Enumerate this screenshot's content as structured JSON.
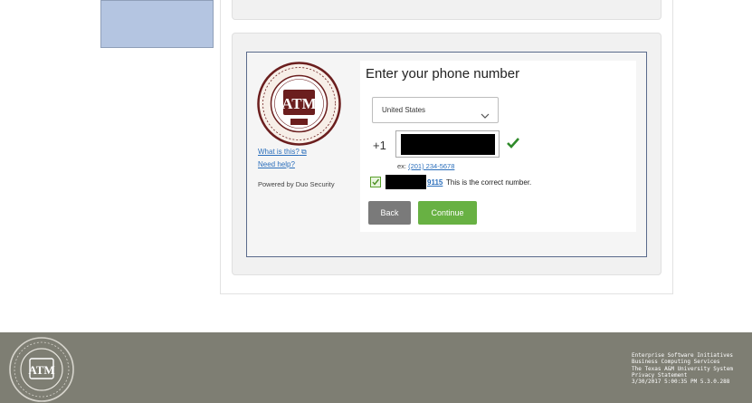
{
  "duo": {
    "title": "Enter your phone number",
    "country_select": {
      "value": "United States"
    },
    "country_code": "+1",
    "phone_value": "",
    "example_prefix": "ex: ",
    "example_number": "(201) 234-5678",
    "confirm_last_digits": "9115",
    "confirm_text": "This is the correct number.",
    "back_label": "Back",
    "continue_label": "Continue"
  },
  "sidebar": {
    "what_is_this": "What is this?",
    "need_help": "Need help?",
    "powered_by": "Powered by Duo Security"
  },
  "footer": {
    "lines": [
      "Enterprise Software Initiatives",
      "Business Computing Services",
      "The Texas A&M University System",
      "Privacy Statement",
      "3/30/2017 5:00:35 PM  5.3.0.288"
    ]
  },
  "colors": {
    "continue": "#68b143",
    "back": "#7a7a7a",
    "link": "#2a6ebb",
    "footer": "#7e7e73",
    "maroon": "#6b1e1e"
  },
  "icons": [
    "university-seal-icon",
    "external-link-icon",
    "chevron-down-icon",
    "checkmark-icon",
    "checkbox-checked-icon"
  ]
}
